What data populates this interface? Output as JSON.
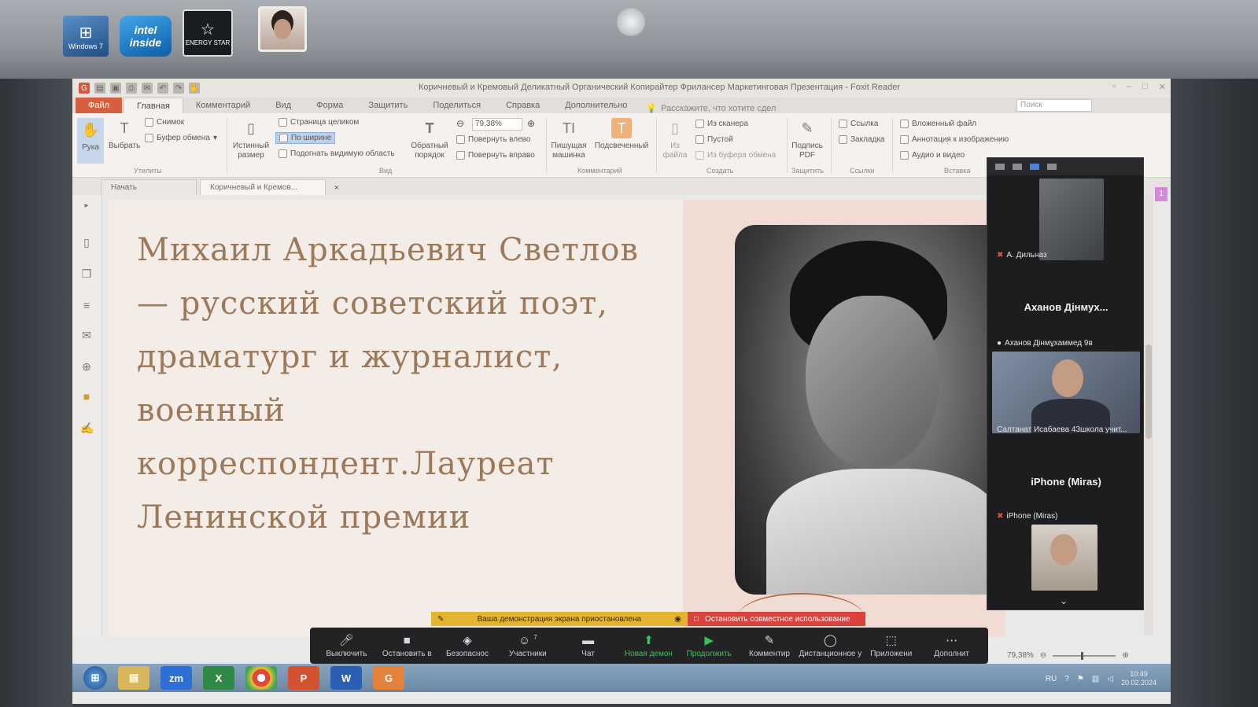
{
  "stickers": {
    "windows": "Windows 7",
    "intel": "intel",
    "intel_sub": "inside",
    "energy": "ENERGY STAR"
  },
  "app": {
    "title": "Коричневый и Кремовый Деликатный Органический Копирайтер Фрилансер Маркетинговая Презентация - Foxit Reader"
  },
  "menu": {
    "tabs": [
      "Файл",
      "Главная",
      "Комментарий",
      "Вид",
      "Форма",
      "Защитить",
      "Поделиться",
      "Справка",
      "Дополнительно"
    ],
    "tell_me": "Расскажите, что хотите сдел",
    "search_placeholder": "Поиск"
  },
  "ribbon": {
    "hand": "Рука",
    "select": "Выбрать",
    "snapshot": "Снимок",
    "clipboard": "Буфер обмена",
    "group_utilities": "Утилиты",
    "actual_size": "Истинный размер",
    "fit_page": "Страница целиком",
    "fit_width": "По ширине",
    "fit_visible": "Подогнать видимую область",
    "reflow": "Обратный порядок",
    "zoom_value": "79,38%",
    "rotate_left": "Повернуть влево",
    "rotate_right": "Повернуть вправо",
    "group_view": "Вид",
    "typewriter": "Пишущая машинка",
    "highlight": "Подсвеченный",
    "group_comment": "Комментарий",
    "from_file": "Из файла",
    "from_scanner": "Из сканера",
    "blank": "Пустой",
    "from_clipboard": "Из буфера обмена",
    "group_create": "Создать",
    "sign_pdf": "Подпись PDF",
    "group_protect": "Защитить",
    "link": "Ссылка",
    "bookmark": "Закладка",
    "group_links": "Ссылки",
    "attached_file": "Вложенный файл",
    "image_annotation": "Аннотация к изображению",
    "audio_video": "Аудио и видео",
    "group_insert": "Вставка"
  },
  "doc_tabs": {
    "start": "Начать",
    "doc": "Коричневый и Кремов..."
  },
  "slide": {
    "lines": [
      "Михаил Аркадьевич Светлов",
      "— русский советский поэт,",
      "драматург и журналист,",
      "военный",
      "корреспондент.Лауреат",
      "Ленинской премии"
    ]
  },
  "zoom_panel": {
    "p1_name": "А. Дильназ",
    "p2_big": "Аханов Дінмух...",
    "p2_name": "Аханов Дінмұхаммед 9в",
    "p3_name": "Салтанат Исабаева 43школа учит...",
    "p4_big": "iPhone (Miras)",
    "p4_name": "iPhone (Miras)"
  },
  "share_banner": {
    "paused": "Ваша демонстрация экрана приостановлена",
    "stop": "Остановить совместное использование"
  },
  "zoom_toolbar": [
    {
      "label": "Выключить",
      "icon": "mic-icon"
    },
    {
      "label": "Остановить в",
      "icon": "video-icon"
    },
    {
      "label": "Безопаснос",
      "icon": "shield-icon"
    },
    {
      "label": "Участники",
      "icon": "participants-icon",
      "count": "7"
    },
    {
      "label": "Чат",
      "icon": "chat-icon"
    },
    {
      "label": "Новая демон",
      "icon": "share-icon"
    },
    {
      "label": "Продолжить",
      "icon": "play-icon"
    },
    {
      "label": "Комментир",
      "icon": "annotate-icon"
    },
    {
      "label": "Дистанционное у",
      "icon": "remote-control-icon"
    },
    {
      "label": "Приложени",
      "icon": "apps-icon"
    },
    {
      "label": "Дополнит",
      "icon": "more-icon"
    }
  ],
  "status": {
    "zoom": "79,38%"
  },
  "taskbar": {
    "zoom_app": "zm",
    "word": "W",
    "lang": "RU",
    "time": "10:49",
    "date": "20.02.2024"
  },
  "colors": {
    "accent_file": "#d65f3d",
    "slide_text": "#9b7a5c",
    "zoom_green": "#37c45b",
    "banner_yellow": "#e3b530",
    "banner_red": "#d9433e"
  }
}
